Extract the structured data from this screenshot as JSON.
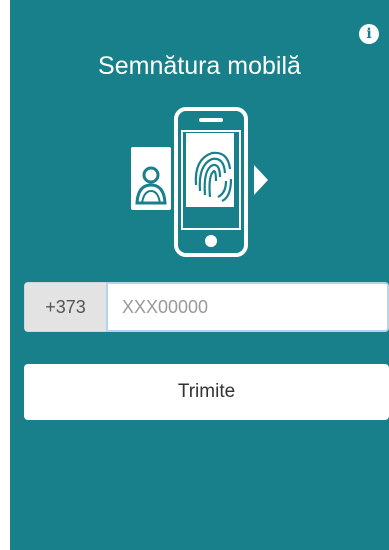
{
  "header": {
    "title": "Semnătura mobilă",
    "info_icon": "info-icon"
  },
  "form": {
    "country_code": "+373",
    "phone_placeholder": "XXX00000",
    "phone_value": "",
    "submit_label": "Trimite"
  },
  "colors": {
    "panel_background": "#17808a",
    "field_background": "#ffffff",
    "prefix_background": "#e3e3e3"
  }
}
